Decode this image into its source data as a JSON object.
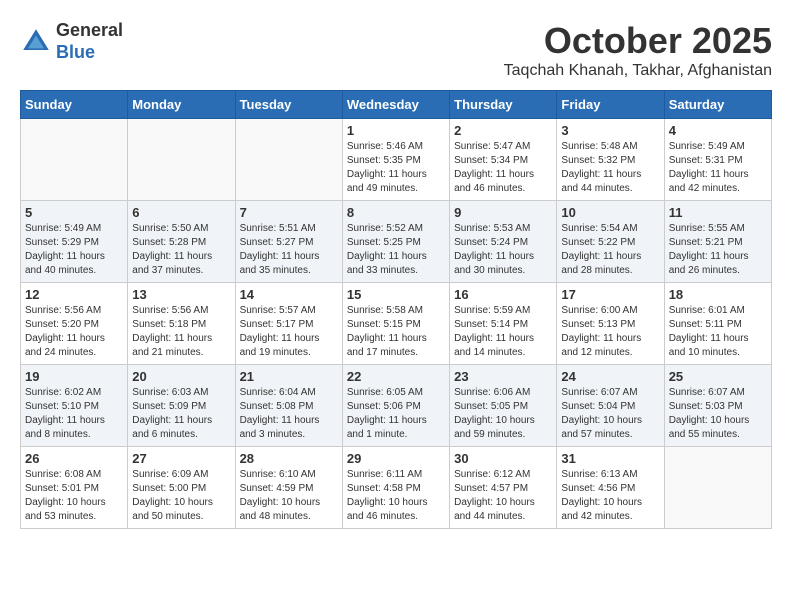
{
  "header": {
    "logo_line1": "General",
    "logo_line2": "Blue",
    "month": "October 2025",
    "location": "Taqchah Khanah, Takhar, Afghanistan"
  },
  "weekdays": [
    "Sunday",
    "Monday",
    "Tuesday",
    "Wednesday",
    "Thursday",
    "Friday",
    "Saturday"
  ],
  "weeks": [
    [
      {
        "day": "",
        "info": ""
      },
      {
        "day": "",
        "info": ""
      },
      {
        "day": "",
        "info": ""
      },
      {
        "day": "1",
        "info": "Sunrise: 5:46 AM\nSunset: 5:35 PM\nDaylight: 11 hours\nand 49 minutes."
      },
      {
        "day": "2",
        "info": "Sunrise: 5:47 AM\nSunset: 5:34 PM\nDaylight: 11 hours\nand 46 minutes."
      },
      {
        "day": "3",
        "info": "Sunrise: 5:48 AM\nSunset: 5:32 PM\nDaylight: 11 hours\nand 44 minutes."
      },
      {
        "day": "4",
        "info": "Sunrise: 5:49 AM\nSunset: 5:31 PM\nDaylight: 11 hours\nand 42 minutes."
      }
    ],
    [
      {
        "day": "5",
        "info": "Sunrise: 5:49 AM\nSunset: 5:29 PM\nDaylight: 11 hours\nand 40 minutes."
      },
      {
        "day": "6",
        "info": "Sunrise: 5:50 AM\nSunset: 5:28 PM\nDaylight: 11 hours\nand 37 minutes."
      },
      {
        "day": "7",
        "info": "Sunrise: 5:51 AM\nSunset: 5:27 PM\nDaylight: 11 hours\nand 35 minutes."
      },
      {
        "day": "8",
        "info": "Sunrise: 5:52 AM\nSunset: 5:25 PM\nDaylight: 11 hours\nand 33 minutes."
      },
      {
        "day": "9",
        "info": "Sunrise: 5:53 AM\nSunset: 5:24 PM\nDaylight: 11 hours\nand 30 minutes."
      },
      {
        "day": "10",
        "info": "Sunrise: 5:54 AM\nSunset: 5:22 PM\nDaylight: 11 hours\nand 28 minutes."
      },
      {
        "day": "11",
        "info": "Sunrise: 5:55 AM\nSunset: 5:21 PM\nDaylight: 11 hours\nand 26 minutes."
      }
    ],
    [
      {
        "day": "12",
        "info": "Sunrise: 5:56 AM\nSunset: 5:20 PM\nDaylight: 11 hours\nand 24 minutes."
      },
      {
        "day": "13",
        "info": "Sunrise: 5:56 AM\nSunset: 5:18 PM\nDaylight: 11 hours\nand 21 minutes."
      },
      {
        "day": "14",
        "info": "Sunrise: 5:57 AM\nSunset: 5:17 PM\nDaylight: 11 hours\nand 19 minutes."
      },
      {
        "day": "15",
        "info": "Sunrise: 5:58 AM\nSunset: 5:15 PM\nDaylight: 11 hours\nand 17 minutes."
      },
      {
        "day": "16",
        "info": "Sunrise: 5:59 AM\nSunset: 5:14 PM\nDaylight: 11 hours\nand 14 minutes."
      },
      {
        "day": "17",
        "info": "Sunrise: 6:00 AM\nSunset: 5:13 PM\nDaylight: 11 hours\nand 12 minutes."
      },
      {
        "day": "18",
        "info": "Sunrise: 6:01 AM\nSunset: 5:11 PM\nDaylight: 11 hours\nand 10 minutes."
      }
    ],
    [
      {
        "day": "19",
        "info": "Sunrise: 6:02 AM\nSunset: 5:10 PM\nDaylight: 11 hours\nand 8 minutes."
      },
      {
        "day": "20",
        "info": "Sunrise: 6:03 AM\nSunset: 5:09 PM\nDaylight: 11 hours\nand 6 minutes."
      },
      {
        "day": "21",
        "info": "Sunrise: 6:04 AM\nSunset: 5:08 PM\nDaylight: 11 hours\nand 3 minutes."
      },
      {
        "day": "22",
        "info": "Sunrise: 6:05 AM\nSunset: 5:06 PM\nDaylight: 11 hours\nand 1 minute."
      },
      {
        "day": "23",
        "info": "Sunrise: 6:06 AM\nSunset: 5:05 PM\nDaylight: 10 hours\nand 59 minutes."
      },
      {
        "day": "24",
        "info": "Sunrise: 6:07 AM\nSunset: 5:04 PM\nDaylight: 10 hours\nand 57 minutes."
      },
      {
        "day": "25",
        "info": "Sunrise: 6:07 AM\nSunset: 5:03 PM\nDaylight: 10 hours\nand 55 minutes."
      }
    ],
    [
      {
        "day": "26",
        "info": "Sunrise: 6:08 AM\nSunset: 5:01 PM\nDaylight: 10 hours\nand 53 minutes."
      },
      {
        "day": "27",
        "info": "Sunrise: 6:09 AM\nSunset: 5:00 PM\nDaylight: 10 hours\nand 50 minutes."
      },
      {
        "day": "28",
        "info": "Sunrise: 6:10 AM\nSunset: 4:59 PM\nDaylight: 10 hours\nand 48 minutes."
      },
      {
        "day": "29",
        "info": "Sunrise: 6:11 AM\nSunset: 4:58 PM\nDaylight: 10 hours\nand 46 minutes."
      },
      {
        "day": "30",
        "info": "Sunrise: 6:12 AM\nSunset: 4:57 PM\nDaylight: 10 hours\nand 44 minutes."
      },
      {
        "day": "31",
        "info": "Sunrise: 6:13 AM\nSunset: 4:56 PM\nDaylight: 10 hours\nand 42 minutes."
      },
      {
        "day": "",
        "info": ""
      }
    ]
  ]
}
